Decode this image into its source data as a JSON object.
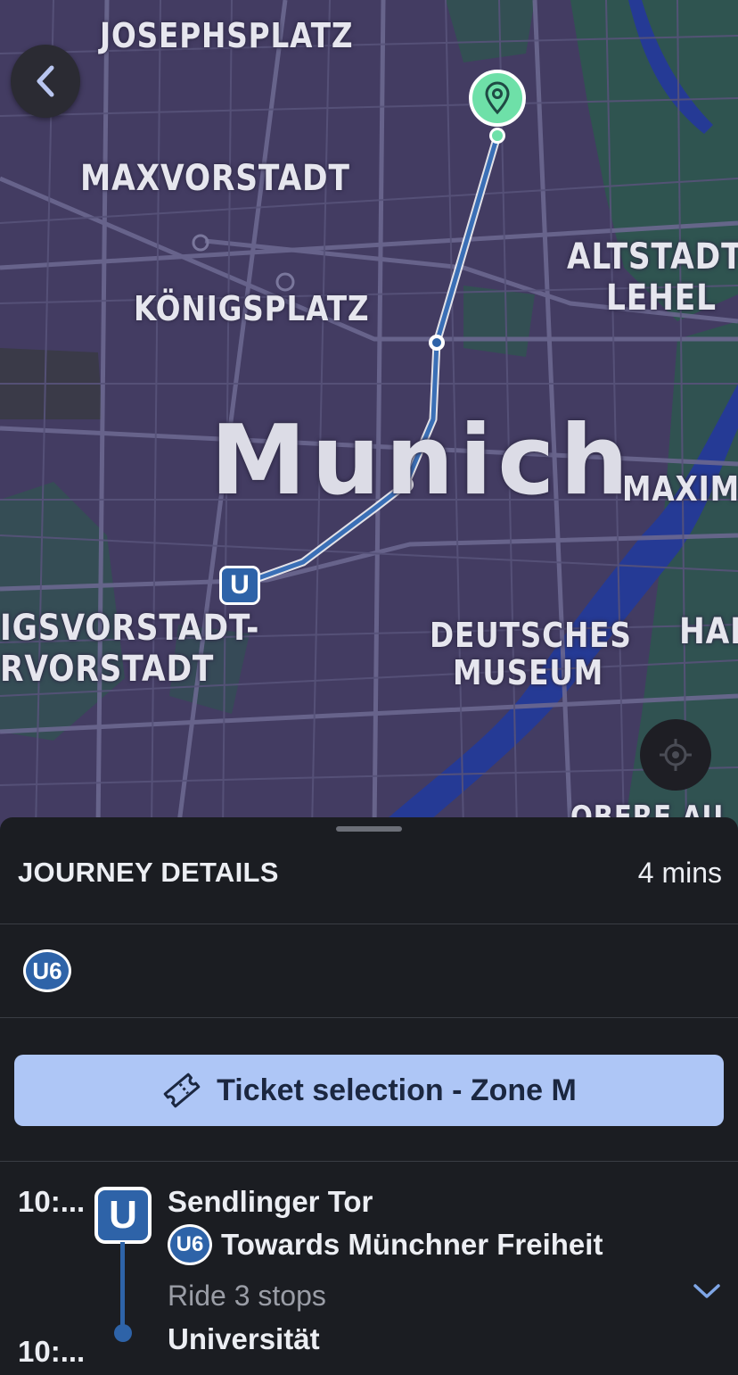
{
  "map": {
    "city_label": "Munich",
    "district_labels": {
      "josephsplatz": "JOSEPHSPLATZ",
      "maxvorstadt": "MAXVORSTADT",
      "koenigsplatz": "KÖNIGSPLATZ",
      "altstadt_1": "ALTSTADT-",
      "altstadt_2": "LEHEL",
      "maximi": "MAXIMI",
      "ludwigsvorstadt_1": "IGSVORSTADT-",
      "ludwigsvorstadt_2": "RVORSTADT",
      "deutsches_1": "DEUTSCHES",
      "deutsches_2": "MUSEUM",
      "hai": "HAI",
      "obere_au": "OBERE AU"
    },
    "origin_marker": "U",
    "icons": {
      "back": "chevron-left-icon",
      "locate": "crosshair-icon",
      "destination": "location-pin-icon"
    },
    "colors": {
      "route": "#2e63a8",
      "destination": "#6ee0a8"
    }
  },
  "sheet": {
    "title": "JOURNEY DETAILS",
    "duration": "4 mins",
    "line_badge": "U6",
    "ticket_button": "Ticket selection - Zone M",
    "ticket_icon": "ticket-icon",
    "leg": {
      "depart_time": "10:...",
      "arrive_time": "10:...",
      "mode_badge": "U",
      "from_stop": "Sendlinger Tor",
      "line": "U6",
      "direction": "Towards Münchner Freiheit",
      "ride_info": "Ride 3 stops",
      "to_stop": "Universität",
      "expand_icon": "chevron-down-icon"
    }
  }
}
